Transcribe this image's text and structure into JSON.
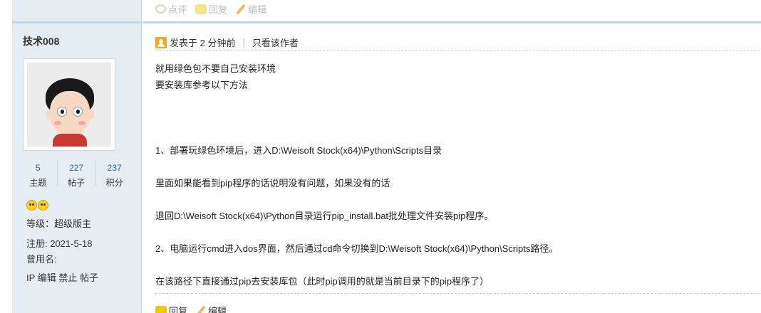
{
  "top_actions": {
    "comment": "点评",
    "reply": "回复",
    "edit": "编辑"
  },
  "author": {
    "name": "技术008",
    "stats": [
      {
        "value": "5",
        "label": "主题"
      },
      {
        "value": "227",
        "label": "帖子"
      },
      {
        "value": "237",
        "label": "积分"
      }
    ],
    "level": "等级：超级版主",
    "register": "注册: 2021-5-18",
    "alias": "曾用名:",
    "admin_links": [
      "IP",
      "编辑",
      "禁止",
      "帖子"
    ]
  },
  "post": {
    "posted_at": "发表于 2 分钟前",
    "only_author": "只看该作者",
    "lines": [
      "就用绿色包不要自己安装环境",
      "要安装库参考以下方法",
      "1、部署玩绿色环境后，进入D:\\Weisoft Stock(x64)\\Python\\Scripts目录",
      "里面如果能看到pip程序的话说明没有问题，如果没有的话",
      "退回D:\\Weisoft Stock(x64)\\Python目录运行pip_install.bat批处理文件安装pip程序。",
      "2、电脑运行cmd进入dos界面，然后通过cd命令切换到D:\\Weisoft Stock(x64)\\Python\\Scripts路径。",
      "在该路径下直接通过pip去安装库包（此时pip调用的就是当前目录下的pip程序了）"
    ]
  },
  "bottom_actions": {
    "reply": "回复",
    "edit": "编辑"
  }
}
